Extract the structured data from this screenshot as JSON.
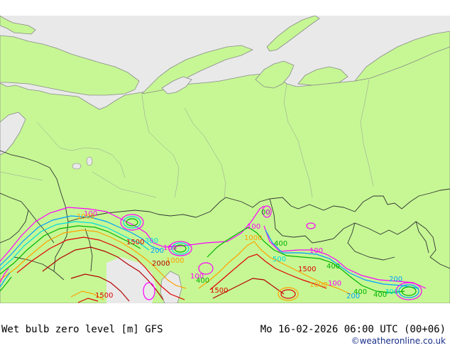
{
  "footer": {
    "product": "Wet bulb zero level [m] GFS",
    "valid": "Mo 16-02-2026 06:00 UTC (00+06)",
    "credit": "©weatheronline.co.uk"
  },
  "map": {
    "colors": {
      "sea": "#e9e9e9",
      "land": "#c6f794",
      "coast": "#8a8a8a",
      "border": "#333333"
    },
    "contour_labels": [
      {
        "text": "100",
        "color": "#ff00ff"
      },
      {
        "text": "100",
        "color": "#ff00ff"
      },
      {
        "text": "100",
        "color": "#ff00ff"
      },
      {
        "text": "100",
        "color": "#ff00ff"
      },
      {
        "text": "100",
        "color": "#ff00ff"
      },
      {
        "text": "100",
        "color": "#ff00ff"
      },
      {
        "text": "200",
        "color": "#00a0ff"
      },
      {
        "text": "200",
        "color": "#00a0ff"
      },
      {
        "text": "200",
        "color": "#00a0ff"
      },
      {
        "text": "300",
        "color": "#00dcdc"
      },
      {
        "text": "300",
        "color": "#00dcdc"
      },
      {
        "text": "400",
        "color": "#00b400"
      },
      {
        "text": "400",
        "color": "#00b400"
      },
      {
        "text": "400",
        "color": "#00b400"
      },
      {
        "text": "400",
        "color": "#00b400"
      },
      {
        "text": "400",
        "color": "#00b400"
      },
      {
        "text": "500",
        "color": "#00dcdc"
      },
      {
        "text": "1000",
        "color": "#ffa000"
      },
      {
        "text": "1000",
        "color": "#ffa000"
      },
      {
        "text": "1000",
        "color": "#ffa000"
      },
      {
        "text": "1000",
        "color": "#ffa000"
      },
      {
        "text": "1500",
        "color": "#e00000"
      },
      {
        "text": "1500",
        "color": "#e00000"
      },
      {
        "text": "1500",
        "color": "#e00000"
      },
      {
        "text": "1500",
        "color": "#e00000"
      },
      {
        "text": "2000",
        "color": "#b40000"
      },
      {
        "text": "00",
        "color": "#00b400"
      },
      {
        "text": "0",
        "color": "#ff00ff"
      }
    ]
  }
}
